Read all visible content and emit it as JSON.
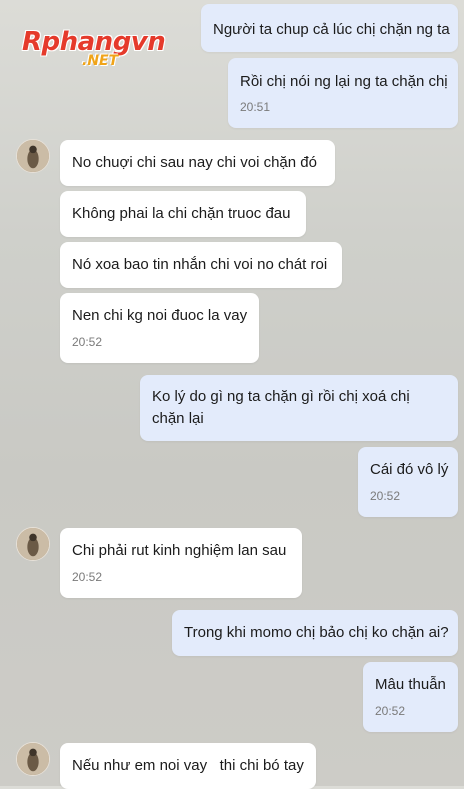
{
  "logo": {
    "main": "Rphangvn",
    "sub": ".NET"
  },
  "messages": [
    {
      "text": "Người ta chup cả lúc chị chặn ng ta"
    },
    {
      "text": "Rồi chị nói ng lại ng ta chặn chị",
      "time": "20:51"
    },
    {
      "text": "No chuợi chi sau nay chi voi chặn đó"
    },
    {
      "text": "Không phai la chi chặn truoc đau"
    },
    {
      "text": "Nó xoa bao tin nhắn chi voi no chát roi"
    },
    {
      "text": "Nen chi kg noi đuoc la vay",
      "time": "20:52"
    },
    {
      "text": "Ko lý do gì ng ta chặn gì rồi chị xoá chị chặn lại"
    },
    {
      "text": "Cái đó vô lý",
      "time": "20:52"
    },
    {
      "text": "Chi phải rut kinh nghiệm lan sau",
      "time": "20:52"
    },
    {
      "text": "Trong khi momo chị bảo chị ko chặn ai?"
    },
    {
      "text": "Mâu thuẫn",
      "time": "20:52"
    },
    {
      "text": "Nếu như em noi vay   thi chi bó tay"
    }
  ]
}
